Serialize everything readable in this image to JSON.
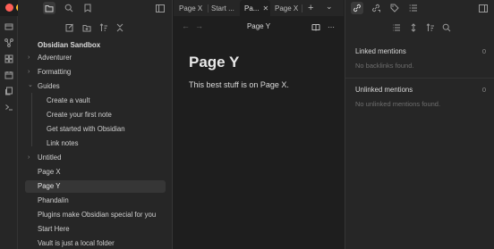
{
  "colors": {
    "traffic_red": "#fe5f57",
    "traffic_yellow": "#febc2e",
    "traffic_green": "#28c840",
    "bg_main": "#1e1e1e",
    "bg_panel": "#262626",
    "active_row": "#363636"
  },
  "file_explorer": {
    "vault_name": "Obsidian Sandbox",
    "items": [
      {
        "label": "Adventurer",
        "type": "folder",
        "expanded": false
      },
      {
        "label": "Formatting",
        "type": "folder",
        "expanded": false
      },
      {
        "label": "Guides",
        "type": "folder",
        "expanded": true
      },
      {
        "label": "Create a vault",
        "type": "file",
        "indent": 1
      },
      {
        "label": "Create your first note",
        "type": "file",
        "indent": 1
      },
      {
        "label": "Get started with Obsidian",
        "type": "file",
        "indent": 1
      },
      {
        "label": "Link notes",
        "type": "file",
        "indent": 1
      },
      {
        "label": "Untitled",
        "type": "folder",
        "expanded": false
      },
      {
        "label": "Page X",
        "type": "file"
      },
      {
        "label": "Page Y",
        "type": "file",
        "active": true
      },
      {
        "label": "Phandalin",
        "type": "file"
      },
      {
        "label": "Plugins make Obsidian special for you",
        "type": "file"
      },
      {
        "label": "Start Here",
        "type": "file"
      },
      {
        "label": "Vault is just a local folder",
        "type": "file"
      }
    ]
  },
  "tabs": [
    {
      "label": "Page X",
      "active": false
    },
    {
      "label": "Start ...",
      "active": false
    },
    {
      "label": "Pa...",
      "active": true
    },
    {
      "label": "Page X",
      "active": false
    }
  ],
  "view": {
    "header_title": "Page Y",
    "back_glyph": "←",
    "forward_glyph": "→",
    "doc_title": "Page Y",
    "doc_body": "This best stuff is on Page X."
  },
  "backlinks": {
    "linked_title": "Linked mentions",
    "linked_count": "0",
    "linked_empty": "No backlinks found.",
    "unlinked_title": "Unlinked mentions",
    "unlinked_count": "0",
    "unlinked_empty": "No unlinked mentions found."
  },
  "glyphs": {
    "new_tab": "+",
    "tab_list": "⌄",
    "close": "✕",
    "more": "⋯",
    "chev_right": "›",
    "chev_down": "⌄"
  }
}
